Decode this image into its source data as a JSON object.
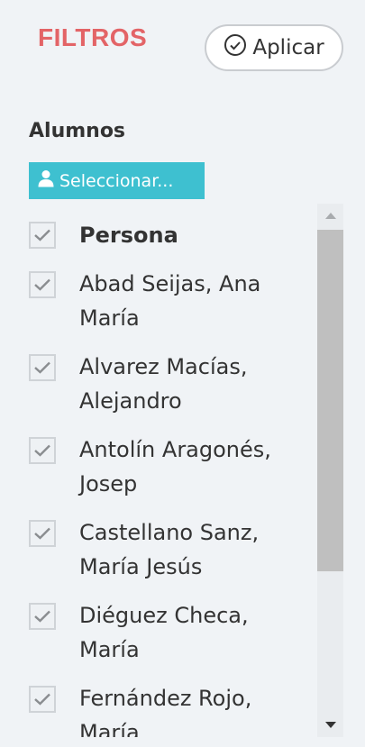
{
  "header": {
    "title": "FILTROS",
    "apply_label": "Aplicar"
  },
  "students": {
    "section_title": "Alumnos",
    "select_label": "Seleccionar...",
    "list_header": "Persona",
    "items": [
      {
        "name": "Abad Seijas, Ana María",
        "checked": true
      },
      {
        "name": "Alvarez Macías, Alejandro",
        "checked": true
      },
      {
        "name": "Antolín Aragonés, Josep",
        "checked": true
      },
      {
        "name": "Castellano Sanz, María Jesús",
        "checked": true
      },
      {
        "name": "Diéguez Checa, María",
        "checked": true
      },
      {
        "name": "Fernández Rojo, María",
        "checked": true
      }
    ]
  },
  "colors": {
    "title": "#e36467",
    "select_button": "#3ec0d0",
    "checkmark": "#8a8d90"
  },
  "icons": {
    "apply": "check-circle-icon",
    "select": "user-icon",
    "checkbox": "check-icon",
    "scroll_up": "triangle-up-icon",
    "scroll_down": "triangle-down-icon"
  }
}
